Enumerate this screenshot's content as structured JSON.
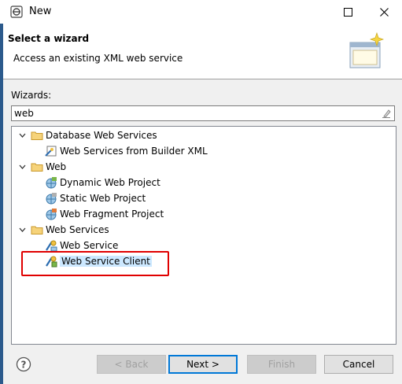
{
  "window": {
    "title": "New"
  },
  "header": {
    "title": "Select a wizard",
    "description": "Access an existing XML web service"
  },
  "wizards": {
    "label": "Wizards:",
    "filter_value": "web",
    "tree": [
      {
        "label": "Database Web Services",
        "type": "folder",
        "expanded": true
      },
      {
        "label": "Web Services from Builder XML",
        "type": "item",
        "icon": "web-services-xml-icon"
      },
      {
        "label": "Web",
        "type": "folder",
        "expanded": true
      },
      {
        "label": "Dynamic Web Project",
        "type": "item",
        "icon": "dynamic-web-project-icon"
      },
      {
        "label": "Static Web Project",
        "type": "item",
        "icon": "static-web-project-icon"
      },
      {
        "label": "Web Fragment Project",
        "type": "item",
        "icon": "web-fragment-project-icon"
      },
      {
        "label": "Web Services",
        "type": "folder",
        "expanded": true
      },
      {
        "label": "Web Service",
        "type": "item",
        "icon": "web-service-icon"
      },
      {
        "label": "Web Service Client",
        "type": "item",
        "icon": "web-service-client-icon",
        "selected": true
      }
    ]
  },
  "buttons": {
    "back": "< Back",
    "next": "Next >",
    "finish": "Finish",
    "cancel": "Cancel"
  },
  "colors": {
    "selection": "#cce8ff",
    "highlight_box": "#e00000",
    "folder": "#e8b74a"
  }
}
